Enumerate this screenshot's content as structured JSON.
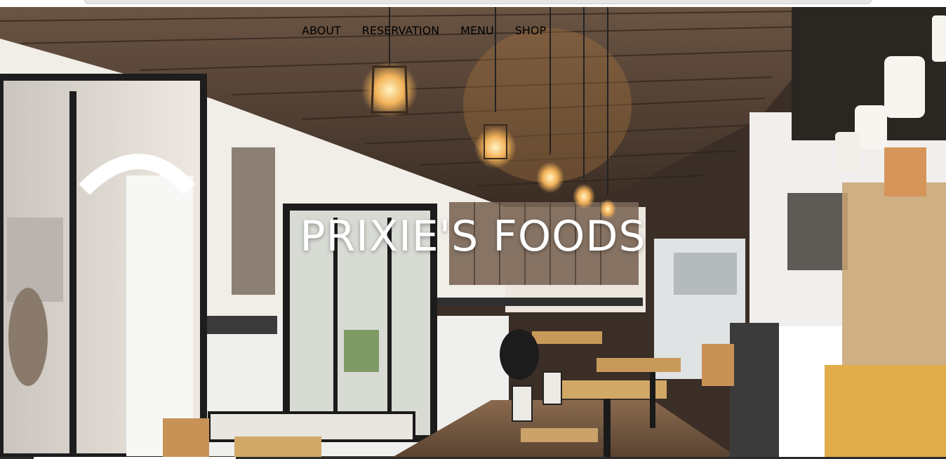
{
  "nav": {
    "items": [
      {
        "label": "ABOUT"
      },
      {
        "label": "RESERVATION"
      },
      {
        "label": "MENU"
      },
      {
        "label": "SHOP"
      }
    ]
  },
  "hero": {
    "title": "PRIXIE'S FOODS"
  },
  "colors": {
    "nav_text": "#ffffff",
    "title_text": "#ffffff",
    "ceiling": "#4a3a2e",
    "wall": "#f1ede7",
    "wood": "#c89a5a"
  }
}
